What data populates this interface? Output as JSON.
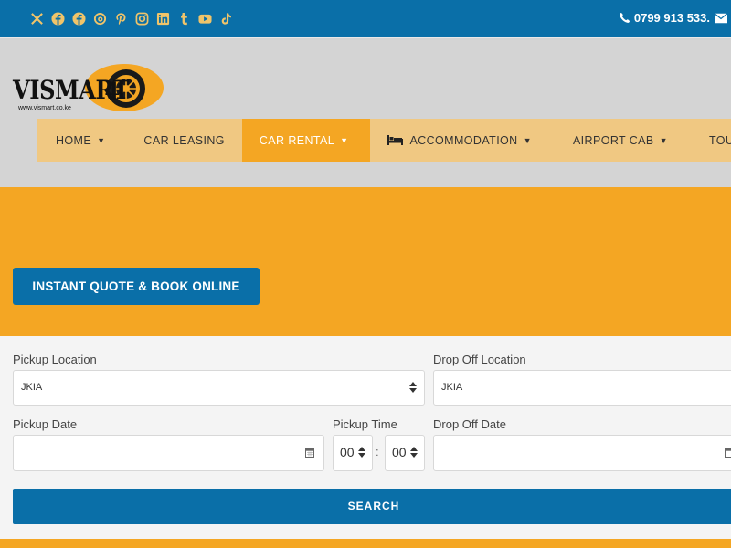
{
  "topbar": {
    "social_icons": [
      "x-icon",
      "facebook-icon",
      "facebook-icon",
      "threads-icon",
      "pinterest-icon",
      "instagram-icon",
      "linkedin-icon",
      "tumblr-icon",
      "youtube-icon",
      "tiktok-icon"
    ],
    "phone": "0799 913 533.",
    "colors": {
      "bar": "#0a6fa8",
      "icon": "#f0c46a"
    }
  },
  "logo": {
    "brand": "VISMART",
    "url": "www.vismart.co.ke"
  },
  "nav": {
    "items": [
      {
        "label": "HOME",
        "dropdown": true
      },
      {
        "label": "CAR LEASING",
        "dropdown": false
      },
      {
        "label": "CAR RENTAL",
        "dropdown": true,
        "active": true
      },
      {
        "label": "ACCOMMODATION",
        "dropdown": true,
        "icon": "bed-icon"
      },
      {
        "label": "AIRPORT CAB",
        "dropdown": true
      },
      {
        "label": "TOURS & TRAV",
        "dropdown": false
      }
    ],
    "colors": {
      "bar": "#f0c882",
      "active": "#f4a623"
    }
  },
  "hero": {
    "button": "INSTANT QUOTE & BOOK ONLINE",
    "color": "#f4a623"
  },
  "form": {
    "pickup_location_label": "Pickup Location",
    "pickup_location_value": "JKIA",
    "dropoff_location_label": "Drop Off Location",
    "dropoff_location_value": "JKIA",
    "pickup_date_label": "Pickup Date",
    "pickup_time_label": "Pickup Time",
    "pickup_hour": "00",
    "pickup_minute": "00",
    "time_separator": ":",
    "dropoff_date_label": "Drop Off Date",
    "search_label": "SEARCH"
  }
}
